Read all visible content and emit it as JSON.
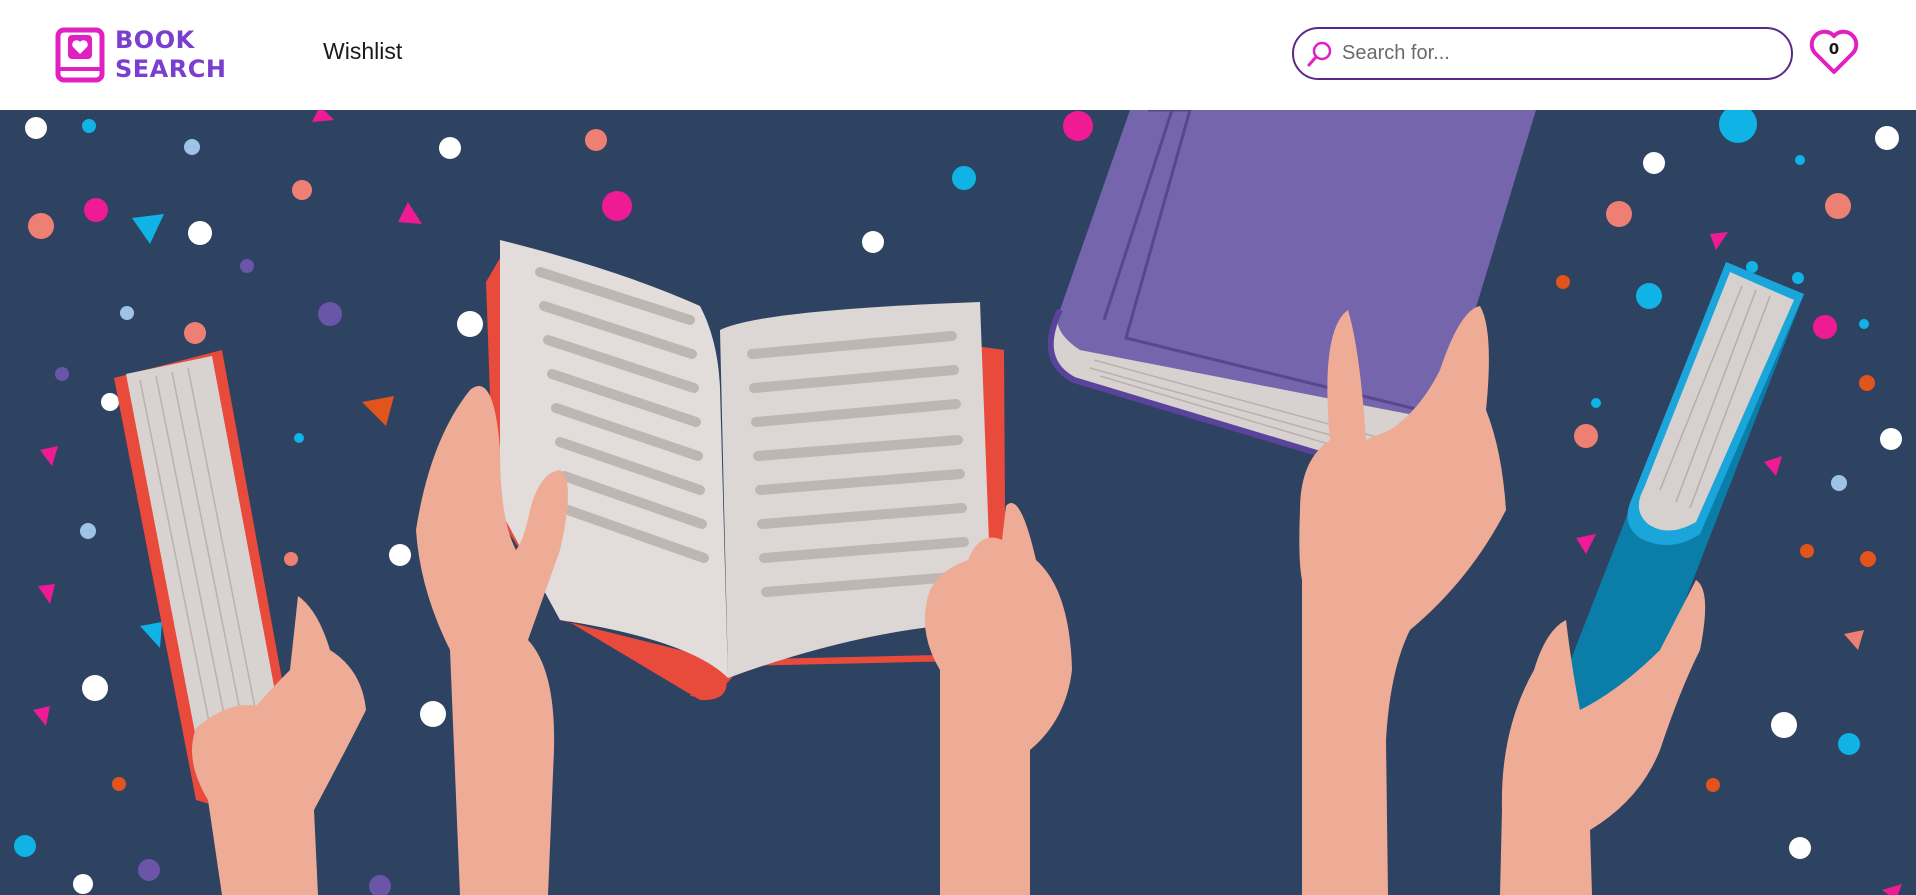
{
  "brand": {
    "line1": "BOOK",
    "line2": "SEARCH",
    "color": "#7a3fd0",
    "icon_color": "#e020c0"
  },
  "nav": {
    "wishlist_label": "Wishlist"
  },
  "search": {
    "placeholder": "Search for...",
    "value": "",
    "icon": "search-icon"
  },
  "wishlist": {
    "icon": "heart-icon",
    "count": "0",
    "color": "#e020c0"
  },
  "hero": {
    "image": "hands-holding-books-illustration",
    "background": "#2e4262"
  }
}
